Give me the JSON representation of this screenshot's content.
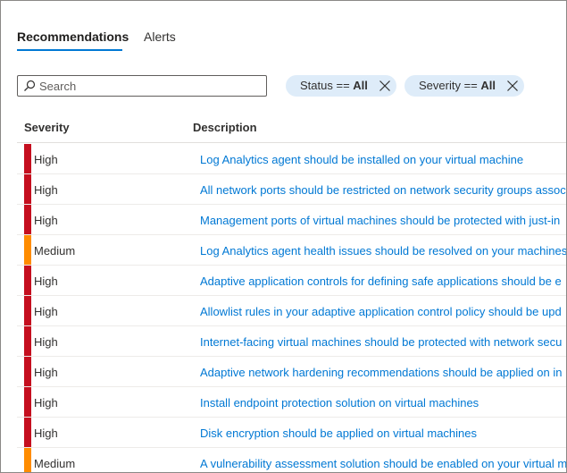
{
  "tabs": [
    {
      "label": "Recommendations",
      "active": true
    },
    {
      "label": "Alerts",
      "active": false
    }
  ],
  "search": {
    "placeholder": "Search",
    "value": ""
  },
  "filters": [
    {
      "key": "Status",
      "op": "==",
      "value": "All"
    },
    {
      "key": "Severity",
      "op": "==",
      "value": "All"
    }
  ],
  "columns": {
    "severity": "Severity",
    "description": "Description"
  },
  "colors": {
    "high": "#c50f1f",
    "medium": "#ff8c00",
    "accent": "#0078d4",
    "pill_bg": "#deecf9"
  },
  "rows": [
    {
      "severity": "High",
      "description": "Log Analytics agent should be installed on your virtual machine"
    },
    {
      "severity": "High",
      "description": "All network ports should be restricted on network security groups assoc"
    },
    {
      "severity": "High",
      "description": "Management ports of virtual machines should be protected with just-in"
    },
    {
      "severity": "Medium",
      "description": "Log Analytics agent health issues should be resolved on your machines"
    },
    {
      "severity": "High",
      "description": "Adaptive application controls for defining safe applications should be e"
    },
    {
      "severity": "High",
      "description": "Allowlist rules in your adaptive application control policy should be upd"
    },
    {
      "severity": "High",
      "description": "Internet-facing virtual machines should be protected with network secu"
    },
    {
      "severity": "High",
      "description": "Adaptive network hardening recommendations should be applied on in"
    },
    {
      "severity": "High",
      "description": "Install endpoint protection solution on virtual machines"
    },
    {
      "severity": "High",
      "description": "Disk encryption should be applied on virtual machines"
    },
    {
      "severity": "Medium",
      "description": "A vulnerability assessment solution should be enabled on your virtual m"
    }
  ]
}
